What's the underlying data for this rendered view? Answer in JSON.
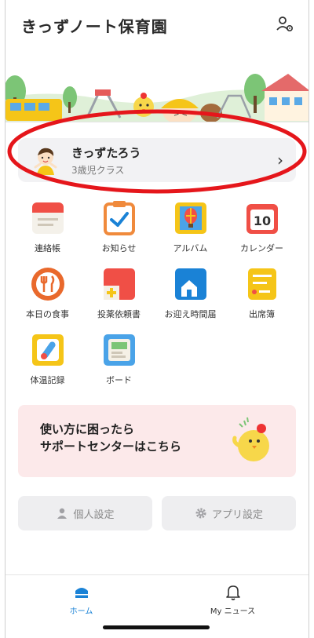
{
  "header": {
    "title": "きっずノート保育園",
    "icon": "switch-account-icon"
  },
  "child": {
    "name": "きっずたろう",
    "class": "3歳児クラス",
    "chevron": "›"
  },
  "menu": [
    {
      "label": "連絡帳",
      "icon": "notebook-icon"
    },
    {
      "label": "お知らせ",
      "icon": "notice-icon"
    },
    {
      "label": "アルバム",
      "icon": "album-icon"
    },
    {
      "label": "カレンダー",
      "icon": "calendar-icon",
      "day": "10"
    },
    {
      "label": "本日の食事",
      "icon": "meal-icon"
    },
    {
      "label": "投薬依頼書",
      "icon": "medicine-icon"
    },
    {
      "label": "お迎え時間届",
      "icon": "pickup-icon"
    },
    {
      "label": "出席簿",
      "icon": "attendance-icon"
    },
    {
      "label": "体温記録",
      "icon": "thermometer-icon"
    },
    {
      "label": "ボード",
      "icon": "board-icon"
    }
  ],
  "support": {
    "line1": "使い方に困ったら",
    "line2": "サポートセンターはこちら"
  },
  "settings": {
    "personal": "個人設定",
    "app": "アプリ設定"
  },
  "tabs": {
    "home": "ホーム",
    "news": "My ニュース"
  },
  "colors": {
    "accent": "#1a82d6",
    "annotation": "#e5161b",
    "support_bg": "#fce9ea"
  }
}
